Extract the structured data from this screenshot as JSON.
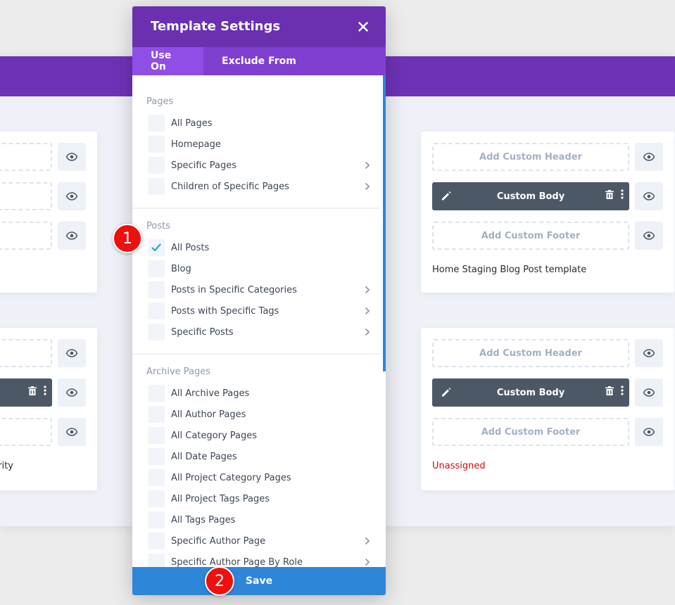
{
  "modal": {
    "title": "Template Settings",
    "tabs": [
      {
        "label": "Use On",
        "active": true
      },
      {
        "label": "Exclude From",
        "active": false
      }
    ],
    "sections": [
      {
        "title": "Pages",
        "options": [
          {
            "label": "All Pages",
            "checked": false,
            "has_submenu": false
          },
          {
            "label": "Homepage",
            "checked": false,
            "has_submenu": false
          },
          {
            "label": "Specific Pages",
            "checked": false,
            "has_submenu": true
          },
          {
            "label": "Children of Specific Pages",
            "checked": false,
            "has_submenu": true
          }
        ]
      },
      {
        "title": "Posts",
        "options": [
          {
            "label": "All Posts",
            "checked": true,
            "has_submenu": false
          },
          {
            "label": "Blog",
            "checked": false,
            "has_submenu": false
          },
          {
            "label": "Posts in Specific Categories",
            "checked": false,
            "has_submenu": true
          },
          {
            "label": "Posts with Specific Tags",
            "checked": false,
            "has_submenu": true
          },
          {
            "label": "Specific Posts",
            "checked": false,
            "has_submenu": true
          }
        ]
      },
      {
        "title": "Archive Pages",
        "options": [
          {
            "label": "All Archive Pages",
            "checked": false,
            "has_submenu": false
          },
          {
            "label": "All Author Pages",
            "checked": false,
            "has_submenu": false
          },
          {
            "label": "All Category Pages",
            "checked": false,
            "has_submenu": false
          },
          {
            "label": "All Date Pages",
            "checked": false,
            "has_submenu": false
          },
          {
            "label": "All Project Category Pages",
            "checked": false,
            "has_submenu": false
          },
          {
            "label": "All Project Tags Pages",
            "checked": false,
            "has_submenu": false
          },
          {
            "label": "All Tags Pages",
            "checked": false,
            "has_submenu": false
          },
          {
            "label": "Specific Author Page",
            "checked": false,
            "has_submenu": true
          },
          {
            "label": "Specific Author Page By Role",
            "checked": false,
            "has_submenu": true
          }
        ]
      }
    ],
    "save_label": "Save"
  },
  "badges": [
    "1",
    "2"
  ],
  "left_cards": [
    {
      "title": "",
      "body_filled": false
    },
    {
      "title": "rity",
      "body_filled": true
    }
  ],
  "right_cards": [
    {
      "header": "Add Custom Header",
      "body": "Custom Body",
      "footer": "Add Custom Footer",
      "title": "Home Staging Blog Post template",
      "unassigned": false
    },
    {
      "header": "Add Custom Header",
      "body": "Custom Body",
      "footer": "Add Custom Footer",
      "title": "Unassigned",
      "unassigned": true
    }
  ],
  "colors": {
    "purple_dark": "#6a30b0",
    "purple_tab": "#7f3fd0",
    "blue_save": "#2e86d9",
    "teal_check": "#20b2aa",
    "badge_red": "#ee0f0f",
    "unassigned_red": "#d00b0b"
  },
  "icons": {
    "close": "close-icon",
    "eye": "eye-icon",
    "pencil": "pencil-icon",
    "trash": "trash-icon",
    "dots": "more-vertical-icon",
    "chevron": "chevron-right-icon",
    "check": "check-icon"
  }
}
